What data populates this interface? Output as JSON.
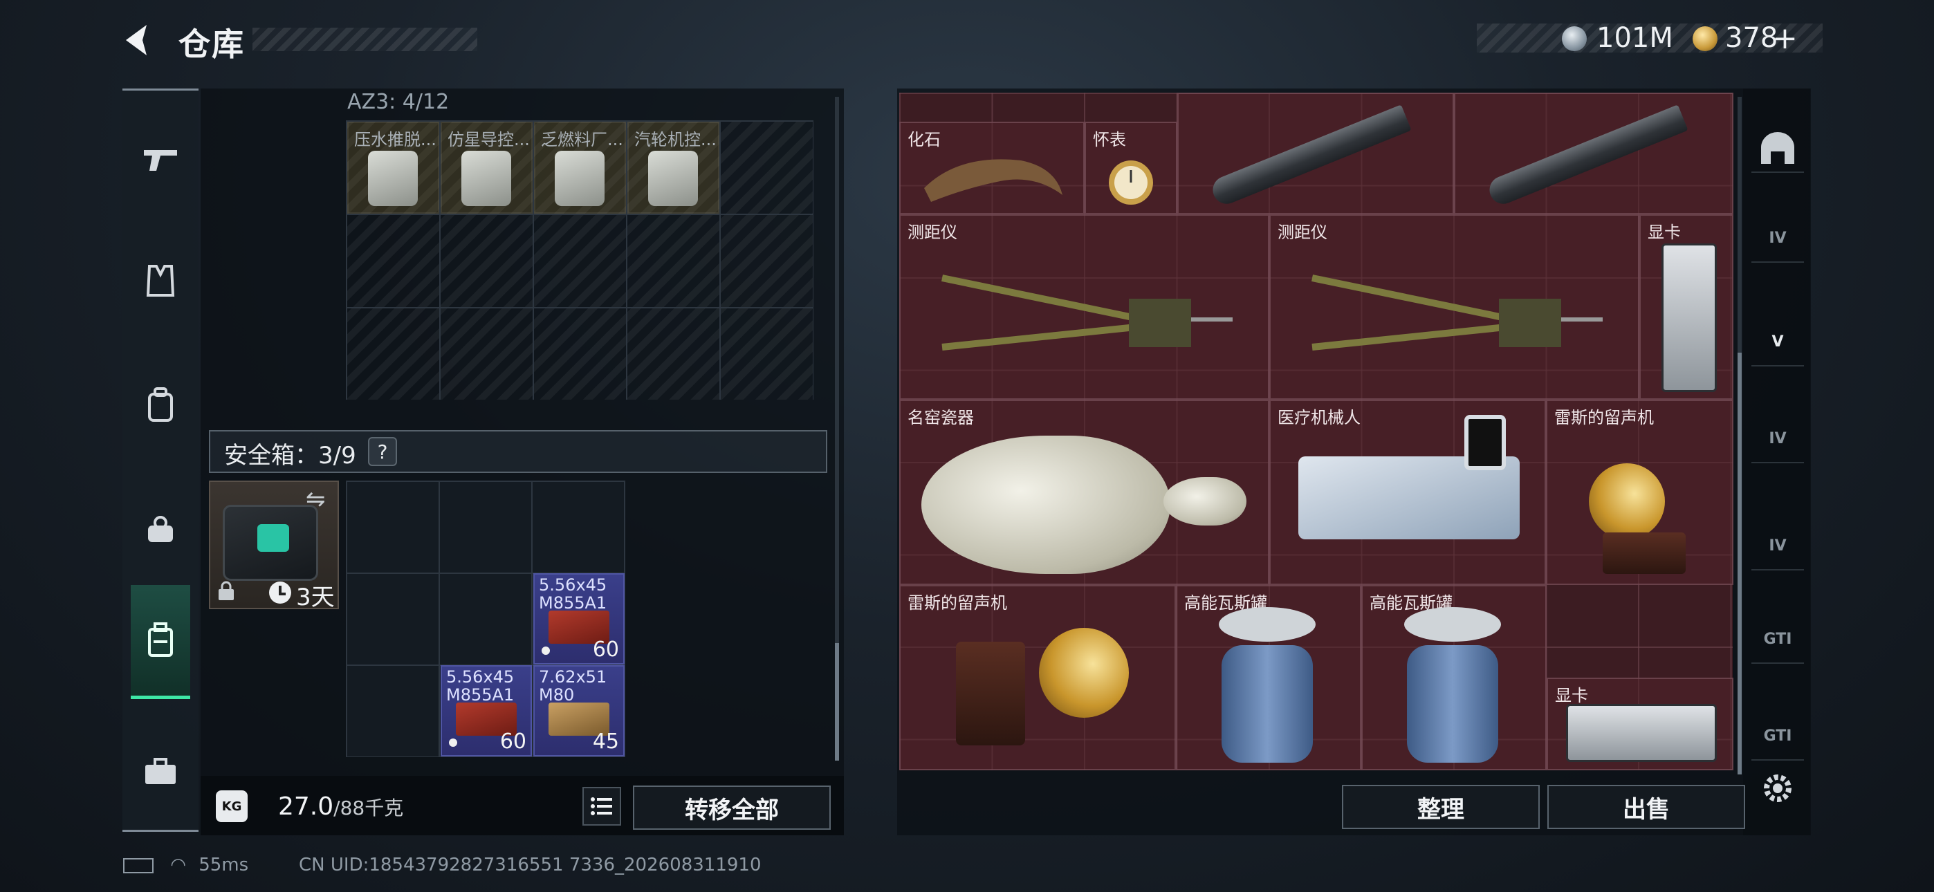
{
  "header": {
    "title": "仓库",
    "currency_silver": "101M",
    "currency_gold": "378"
  },
  "left_rail": {
    "items": [
      "pistol-icon",
      "vest-icon",
      "backpack-icon",
      "chest-rig-icon",
      "safe-case-icon",
      "briefcase-icon"
    ],
    "active_index": 4
  },
  "az_section": {
    "label": "AZ3: 4/12",
    "items": [
      {
        "label": "压水推脱..."
      },
      {
        "label": "仿星导控..."
      },
      {
        "label": "乏燃料厂..."
      },
      {
        "label": "汽轮机控..."
      }
    ]
  },
  "safe_box": {
    "title": "安全箱：3/9",
    "help": "?",
    "duration": "3天",
    "ammo": [
      {
        "name_line1": "5.56x45",
        "name_line2": "M855A1",
        "count": "60"
      },
      {
        "name_line1": "5.56x45",
        "name_line2": "M855A1",
        "count": "60"
      },
      {
        "name_line1": "7.62x51",
        "name_line2": "M80",
        "count": "45"
      }
    ]
  },
  "footer_left": {
    "kg_label": "KG",
    "weight": "27.0",
    "weight_max": "/88千克",
    "transfer_all": "转移全部"
  },
  "inventory": {
    "items": [
      {
        "label": "化石"
      },
      {
        "label": "怀表"
      },
      {
        "label": "测距仪"
      },
      {
        "label": "测距仪"
      },
      {
        "label": "显卡"
      },
      {
        "label": "名窑瓷器"
      },
      {
        "label": "医疗机械人"
      },
      {
        "label": "雷斯的留声机"
      },
      {
        "label": "雷斯的留声机"
      },
      {
        "label": "高能瓦斯罐"
      },
      {
        "label": "高能瓦斯罐"
      },
      {
        "label": "显卡"
      }
    ]
  },
  "right_rail": {
    "items": [
      "bunker-icon",
      "IV",
      "V",
      "IV",
      "IV",
      "GTI",
      "GTI"
    ]
  },
  "footer_right": {
    "sort": "整理",
    "sell": "出售"
  },
  "status": {
    "ping": "55ms",
    "uid": "CN UID:18543792827316551 7336_202608311910"
  },
  "colors": {
    "accent_green": "#3ee7a6",
    "ammo_blue": "#3a3f8a",
    "inventory_bg": "#3c1c22"
  }
}
